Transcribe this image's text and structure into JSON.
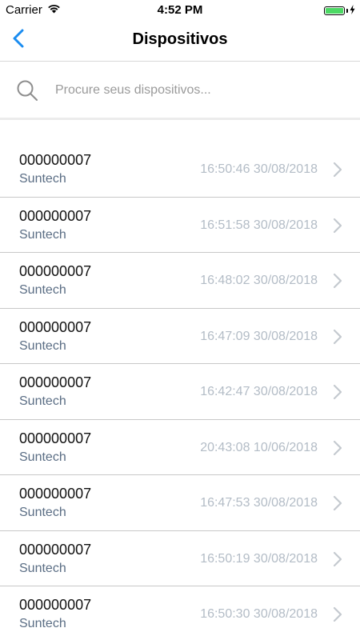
{
  "status_bar": {
    "carrier": "Carrier",
    "time": "4:52 PM",
    "icons": [
      "wifi-icon",
      "battery-icon",
      "charging-bolt-icon"
    ],
    "battery_color": "#4cd964"
  },
  "nav": {
    "title": "Dispositivos",
    "back_icon": "chevron-left-icon",
    "accent_color": "#1a8cf0"
  },
  "search": {
    "placeholder": "Procure seus dispositivos...",
    "value": "",
    "icon": "search-icon"
  },
  "devices": [
    {
      "id": "000000007",
      "brand": "Suntech",
      "timestamp": "16:50:46 30/08/2018"
    },
    {
      "id": "000000007",
      "brand": "Suntech",
      "timestamp": "16:51:58 30/08/2018"
    },
    {
      "id": "000000007",
      "brand": "Suntech",
      "timestamp": "16:48:02 30/08/2018"
    },
    {
      "id": "000000007",
      "brand": "Suntech",
      "timestamp": "16:47:09 30/08/2018"
    },
    {
      "id": "000000007",
      "brand": "Suntech",
      "timestamp": "16:42:47 30/08/2018"
    },
    {
      "id": "000000007",
      "brand": "Suntech",
      "timestamp": "20:43:08 10/06/2018"
    },
    {
      "id": "000000007",
      "brand": "Suntech",
      "timestamp": "16:47:53 30/08/2018"
    },
    {
      "id": "000000007",
      "brand": "Suntech",
      "timestamp": "16:50:19 30/08/2018"
    },
    {
      "id": "000000007",
      "brand": "Suntech",
      "timestamp": "16:50:30 30/08/2018"
    }
  ]
}
